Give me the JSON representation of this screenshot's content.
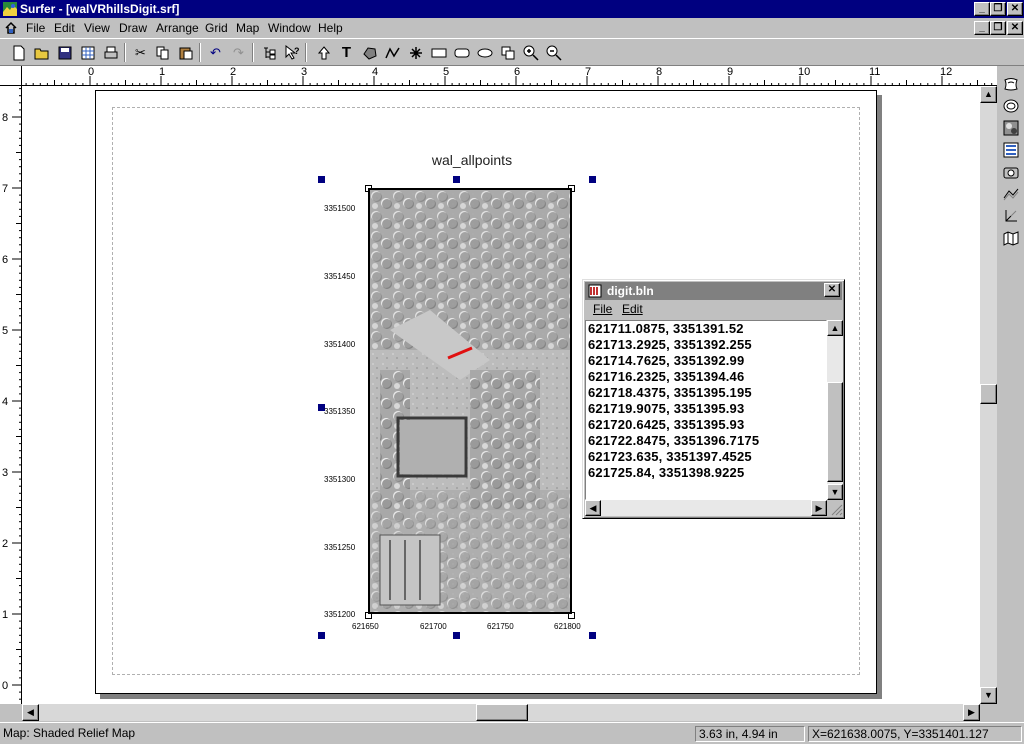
{
  "app": {
    "title": "Surfer - [walVRhillsDigit.srf]"
  },
  "window_controls": {
    "minimize": "_",
    "restore": "❐",
    "close": "✕"
  },
  "menu": [
    "File",
    "Edit",
    "View",
    "Draw",
    "Arrange",
    "Grid",
    "Map",
    "Window",
    "Help"
  ],
  "toolbar": {
    "buttons": [
      "new-document",
      "open-folder",
      "save",
      "data-sheet",
      "print",
      "cut",
      "copy",
      "paste",
      "undo",
      "redo",
      "object-manager",
      "help-pointer",
      "select-arrow",
      "text",
      "polygon",
      "polyline",
      "symbol",
      "rectangle",
      "rounded-rectangle",
      "ellipse",
      "reshape",
      "zoom-in",
      "zoom-out"
    ]
  },
  "ruler": {
    "h_labels": [
      "0",
      "1",
      "2",
      "3",
      "4",
      "5",
      "6",
      "7",
      "8",
      "9",
      "10",
      "11",
      "12"
    ],
    "v_labels": [
      "8",
      "7",
      "6",
      "5",
      "4",
      "3",
      "2",
      "1",
      "0"
    ]
  },
  "map": {
    "title": "wal_allpoints",
    "y_ticks": [
      "3351500",
      "3351450",
      "3351400",
      "3351350",
      "3351300",
      "3351250",
      "3351200"
    ],
    "x_ticks": [
      "621650",
      "621700",
      "621750",
      "621800"
    ]
  },
  "digit_window": {
    "title": "digit.bln",
    "menu": [
      "File",
      "Edit"
    ],
    "lines": [
      "621711.0875, 3351391.52",
      "621713.2925, 3351392.255",
      "621714.7625, 3351392.99",
      "621716.2325, 3351394.46",
      "621718.4375, 3351395.195",
      "621719.9075, 3351395.93",
      "621720.6425, 3351395.93",
      "621722.8475, 3351396.7175",
      "621723.635, 3351397.4525",
      "621725.84, 3351398.9225"
    ]
  },
  "right_toolbar": [
    "contour-map-icon",
    "image-map-icon",
    "shaded-relief-icon",
    "vector-map-icon",
    "post-map-icon",
    "3d-surface-icon",
    "3d-wireframe-icon",
    "base-map-icon"
  ],
  "status": {
    "object": "Map: Shaded Relief Map",
    "size": "3.63 in, 4.94 in",
    "coords": "X=621638.0075, Y=3351401.127"
  },
  "colors": {
    "titlebar": "#000080",
    "inactive_title": "#808080",
    "chrome": "#c0c0c0",
    "digitized_line": "#e01010"
  }
}
